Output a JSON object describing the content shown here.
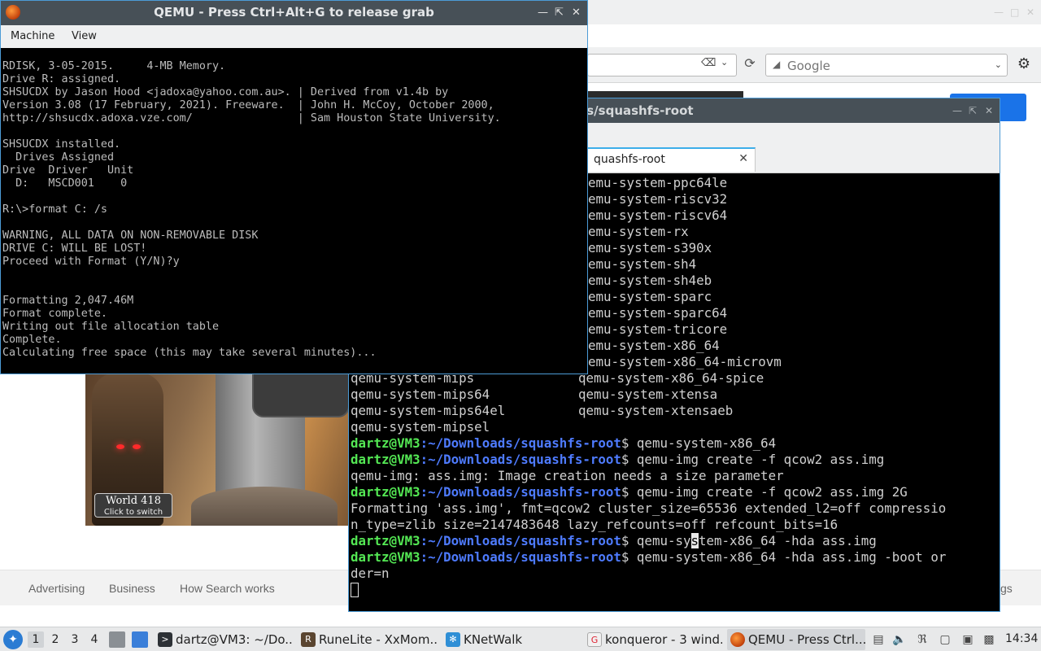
{
  "browser": {
    "search_placeholder": "Google",
    "footer_links": [
      "Advertising",
      "Business",
      "How Search works"
    ],
    "footer_partial": "gs"
  },
  "game": {
    "world_title": "World 418",
    "world_sub": "Click to switch"
  },
  "terminal": {
    "title": "VM3: ~/Downloads/squashfs-root",
    "tab_label": "quashfs-root",
    "list_right_col": [
      "emu-system-ppc64le",
      "emu-system-riscv32",
      "emu-system-riscv64",
      "emu-system-rx",
      "emu-system-s390x",
      "emu-system-sh4",
      "emu-system-sh4eb",
      "emu-system-sparc",
      "emu-system-sparc64",
      "emu-system-tricore",
      "emu-system-x86_64",
      "emu-system-x86_64-microvm"
    ],
    "list_two_col": [
      [
        "qemu-system-mips",
        "qemu-system-x86_64-spice"
      ],
      [
        "qemu-system-mips64",
        "qemu-system-xtensa"
      ],
      [
        "qemu-system-mips64el",
        "qemu-system-xtensaeb"
      ],
      [
        "qemu-system-mipsel",
        ""
      ]
    ],
    "prompt_user": "dartz@VM3",
    "prompt_path": ":~/Downloads/squashfs-root",
    "prompt_symbol": "$",
    "cmd1": " qemu-system-x86_64",
    "cmd2": " qemu-img create -f qcow2 ass.img",
    "out2": "qemu-img: ass.img: Image creation needs a size parameter",
    "cmd3": " qemu-img create -f qcow2 ass.img 2G",
    "out3a": "Formatting 'ass.img', fmt=qcow2 cluster_size=65536 extended_l2=off compressio",
    "out3b": "n_type=zlib size=2147483648 lazy_refcounts=off refcount_bits=16",
    "cmd4_pre": " qemu-sy",
    "cmd4_cursor": "s",
    "cmd4_post": "tem-x86_64 -hda ass.img",
    "cmd5a": " qemu-system-x86_64 -hda ass.img -boot or",
    "cmd5b": "der=n"
  },
  "qemu": {
    "title": "QEMU - Press Ctrl+Alt+G to release grab",
    "menu": [
      "Machine",
      "View"
    ],
    "screen_lines": [
      "RDISK, 3-05-2015.     4-MB Memory.",
      "Drive R: assigned.",
      "SHSUCDX by Jason Hood <jadoxa@yahoo.com.au>. | Derived from v1.4b by",
      "Version 3.08 (17 February, 2021). Freeware.  | John H. McCoy, October 2000,",
      "http://shsucdx.adoxa.vze.com/                | Sam Houston State University.",
      "",
      "SHSUCDX installed.",
      "  Drives Assigned",
      "Drive  Driver   Unit",
      "  D:   MSCD001    0",
      "",
      "R:\\>format C: /s",
      "",
      "WARNING, ALL DATA ON NON-REMOVABLE DISK",
      "DRIVE C: WILL BE LOST!",
      "Proceed with Format (Y/N)?y",
      "",
      "",
      "Formatting 2,047.46M",
      "Format complete.",
      "Writing out file allocation table",
      "Complete.",
      "Calculating free space (this may take several minutes)..."
    ]
  },
  "taskbar": {
    "workspaces": [
      "1",
      "2",
      "3",
      "4"
    ],
    "tasks": [
      {
        "label": "dartz@VM3: ~/Do..."
      },
      {
        "label": "RuneLite - XxMom..."
      },
      {
        "label": "KNetWalk"
      },
      {
        "label": "konqueror - 3 wind..."
      },
      {
        "label": "QEMU - Press Ctrl..."
      }
    ],
    "clock": "14:34"
  },
  "colors": {
    "titlebar": "#475057",
    "accent": "#3daee9",
    "prompt_green": "#54e854",
    "prompt_blue": "#4e7bff",
    "search_button": "#1a73e8"
  }
}
